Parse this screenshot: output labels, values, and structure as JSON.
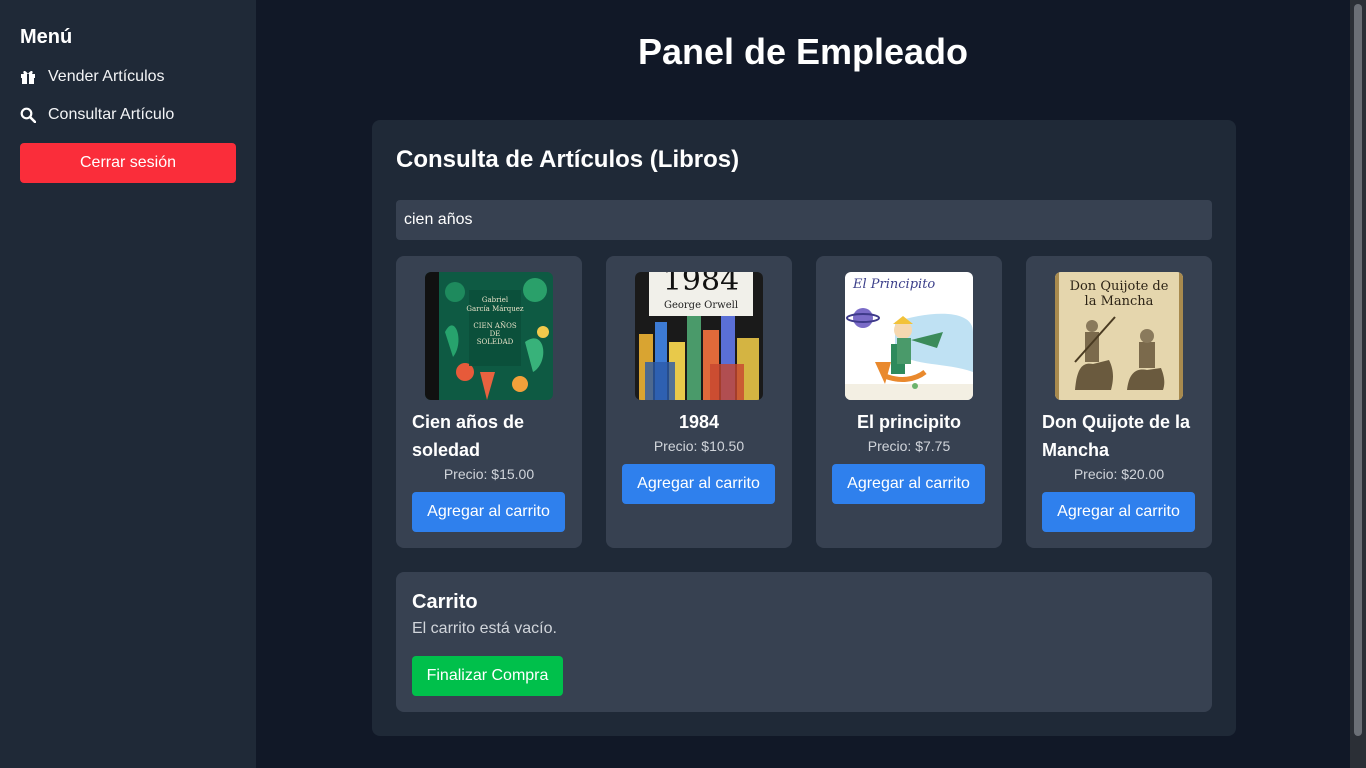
{
  "sidebar": {
    "title": "Menú",
    "items": [
      {
        "label": "Vender Artículos",
        "icon": "gift-icon"
      },
      {
        "label": "Consultar Artículo",
        "icon": "search-icon"
      }
    ],
    "logout_label": "Cerrar sesión"
  },
  "page": {
    "title": "Panel de Empleado"
  },
  "panel": {
    "title": "Consulta de Artículos (Libros)",
    "search_value": "cien años"
  },
  "books": [
    {
      "title": "Cien años de soledad",
      "price": "Precio: $15.00",
      "button": "Agregar al carrito",
      "cover_line1": "Gabriel",
      "cover_line2": "García Márquez",
      "cover_line3": "CIEN AÑOS",
      "cover_line4": "DE",
      "cover_line5": "SOLEDAD"
    },
    {
      "title": "1984",
      "price": "Precio: $10.50",
      "button": "Agregar al carrito",
      "cover_line1": "1984",
      "cover_line2": "George Orwell"
    },
    {
      "title": "El principito",
      "price": "Precio: $7.75",
      "button": "Agregar al carrito",
      "cover_line1": "El Principito"
    },
    {
      "title": "Don Quijote de la Mancha",
      "price": "Precio: $20.00",
      "button": "Agregar al carrito",
      "cover_line1": "Don Quijote de",
      "cover_line2": "la Mancha"
    }
  ],
  "cart": {
    "title": "Carrito",
    "empty_text": "El carrito está vacío.",
    "checkout_label": "Finalizar Compra"
  },
  "colors": {
    "background": "#111827",
    "sidebar": "#1f2937",
    "card": "#374151",
    "primary": "#2f80ed",
    "danger": "#fa2d3a",
    "success": "#00c04b"
  }
}
